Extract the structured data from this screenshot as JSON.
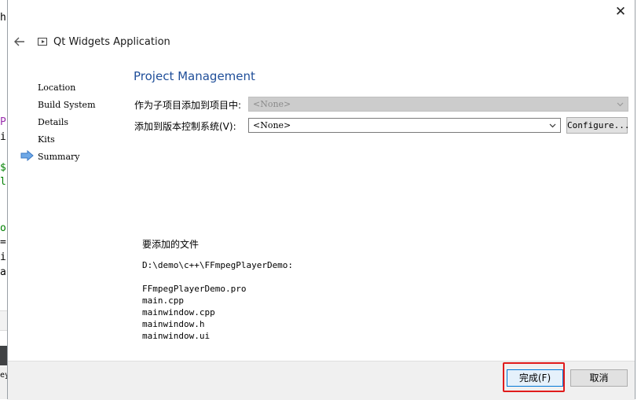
{
  "background_editor": {
    "lines": [
      "h",
      "P",
      "i",
      "$",
      "l",
      "o",
      "=",
      "i",
      "a",
      "ey"
    ]
  },
  "dialog": {
    "close_glyph": "✕",
    "title": "Qt Widgets Application",
    "steps": [
      {
        "label": "Location"
      },
      {
        "label": "Build System"
      },
      {
        "label": "Details"
      },
      {
        "label": "Kits"
      },
      {
        "label": "Summary",
        "current": true
      }
    ],
    "heading": "Project Management",
    "subproject_label": "作为子项目添加到项目中:",
    "subproject_value": "<None>",
    "vcs_label": "添加到版本控制系统(V):",
    "vcs_value": "<None>",
    "configure_label": "Configure...",
    "files_heading": "要添加的文件",
    "files_path": "D:\\demo\\c++\\FFmpegPlayerDemo:",
    "files": [
      "FFmpegPlayerDemo.pro",
      "main.cpp",
      "mainwindow.cpp",
      "mainwindow.h",
      "mainwindow.ui"
    ],
    "finish_label": "完成(F)",
    "cancel_label": "取消"
  },
  "colors": {
    "heading": "#1f4e99",
    "highlight": "#e01b1b",
    "current_step_arrow": "#4a90d9"
  }
}
